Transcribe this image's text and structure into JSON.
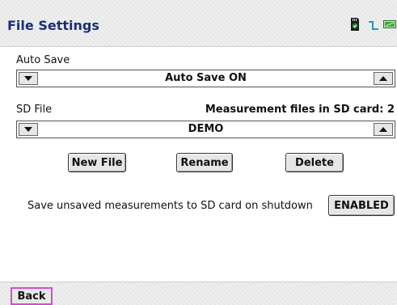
{
  "header": {
    "title": "File Settings",
    "icons": [
      "sd-card-icon",
      "signal-icon",
      "battery-icon"
    ]
  },
  "auto_save": {
    "label": "Auto Save",
    "value": "Auto Save ON"
  },
  "sd_file": {
    "label": "SD File",
    "count_text": "Measurement files in SD card: 2",
    "value": "DEMO"
  },
  "file_buttons": {
    "new_file": "New File",
    "rename": "Rename",
    "delete": "Delete"
  },
  "shutdown": {
    "text": "Save unsaved measurements to SD card on shutdown",
    "button": "ENABLED"
  },
  "footer": {
    "back": "Back"
  },
  "colors": {
    "title": "#1a2f7a",
    "back_border": "#d04fcf",
    "sd_icon": "#2a7d2a",
    "signal": "#1f9fb0",
    "battery": "#3fa63f"
  }
}
